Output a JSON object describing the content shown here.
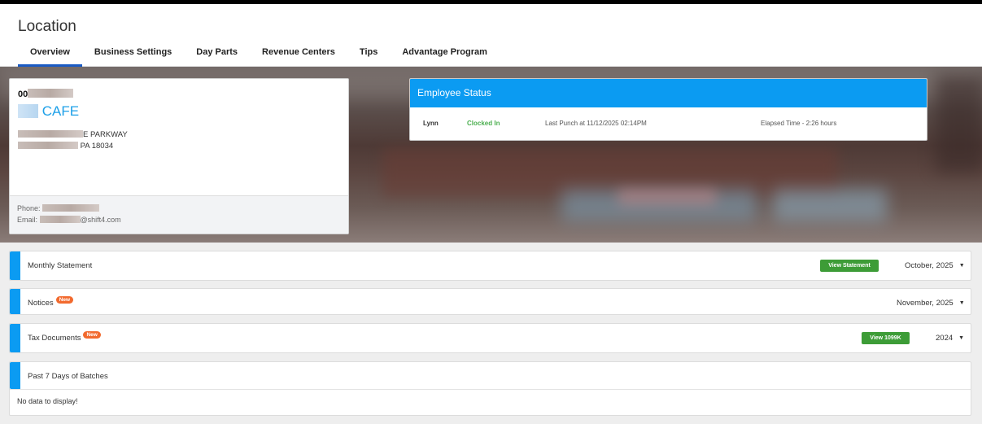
{
  "header": {
    "title": "Location",
    "tabs": [
      {
        "label": "Overview",
        "active": true
      },
      {
        "label": "Business Settings"
      },
      {
        "label": "Day Parts"
      },
      {
        "label": "Revenue Centers"
      },
      {
        "label": "Tips"
      },
      {
        "label": "Advantage Program"
      }
    ]
  },
  "location": {
    "id_prefix": "00",
    "name_suffix": "CAFE",
    "address_line1_suffix": "E PARKWAY",
    "address_line2_suffix": "PA 18034",
    "phone_label": "Phone:",
    "email_label": "Email:",
    "email_suffix": "@shift4.com"
  },
  "employee_status": {
    "title": "Employee Status",
    "rows": [
      {
        "name": "Lynn",
        "status": "Clocked In",
        "last_punch": "Last Punch at 11/12/2025 02:14PM",
        "elapsed": "Elapsed Time - 2:26 hours"
      }
    ]
  },
  "panels": {
    "monthly_statement": {
      "title": "Monthly Statement",
      "button": "View Statement",
      "selected": "October, 2025"
    },
    "notices": {
      "title": "Notices",
      "badge": "New",
      "selected": "November, 2025"
    },
    "tax_documents": {
      "title": "Tax Documents",
      "badge": "New",
      "button": "View 1099K",
      "selected": "2024"
    },
    "batches": {
      "title": "Past 7 Days of Batches",
      "empty_message": "No data to display!"
    }
  },
  "colors": {
    "accent_blue": "#0b9bf2",
    "tab_underline": "#1a5bc4",
    "green_button": "#3d9c37",
    "badge_orange": "#f26a2e",
    "status_green": "#4caf50"
  }
}
